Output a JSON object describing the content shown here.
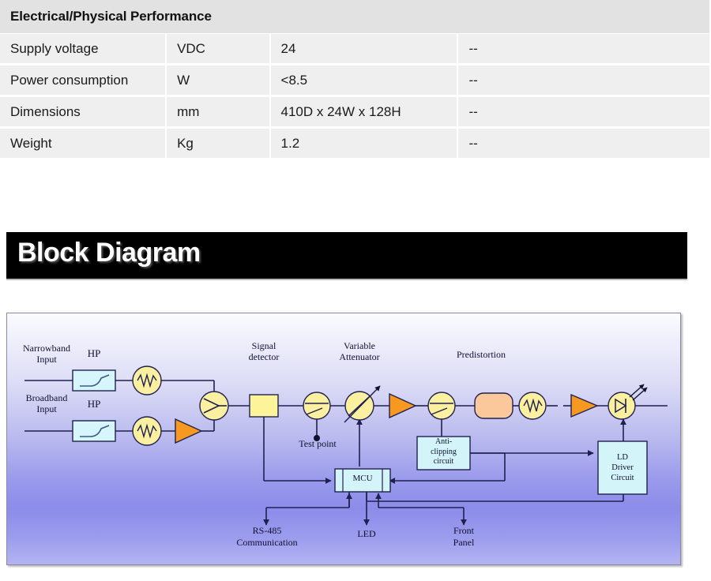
{
  "spec_table": {
    "header": "Electrical/Physical Performance",
    "rows": [
      {
        "parameter": "Supply voltage",
        "unit": "VDC",
        "value": "24",
        "note": "--"
      },
      {
        "parameter": "Power consumption",
        "unit": "W",
        "value": "<8.5",
        "note": "--"
      },
      {
        "parameter": "Dimensions",
        "unit": "mm",
        "value": "410D x 24W x 128H",
        "note": "--"
      },
      {
        "parameter": "Weight",
        "unit": "Kg",
        "value": "1.2",
        "note": "--"
      }
    ]
  },
  "banner": {
    "title": "Block Diagram"
  },
  "diagram": {
    "labels": {
      "narrowband_input": "Narrowband",
      "narrowband_input2": "Input",
      "broadband_input": "Broadband",
      "broadband_input2": "Input",
      "hp_top": "HP",
      "hp_bottom": "HP",
      "signal_detector": "Signal",
      "signal_detector2": "detector",
      "variable_attenuator": "Variable",
      "variable_attenuator2": "Attenuator",
      "predistortion": "Predistortion",
      "test_point": "Test point",
      "anti_clipping_1": "Anti-",
      "anti_clipping_2": "clipping",
      "anti_clipping_3": "circuit",
      "ld_driver_1": "LD",
      "ld_driver_2": "Driver",
      "ld_driver_3": "Circuit",
      "mcu": "MCU",
      "rs485_1": "RS-485",
      "rs485_2": "Communication",
      "led": "LED",
      "front_panel_1": "Front",
      "front_panel_2": "Panel"
    },
    "colors": {
      "filter_fill": "#d6f6fb",
      "circle_fill": "#fbf0a0",
      "amp_fill": "#f79820",
      "detector_fill": "#fdf49a",
      "predistortion_fill": "#fac89a",
      "box_fill": "#d3f4f9",
      "line": "#202050",
      "frame_border": "#8a8aa8",
      "banner_bg": "#000000",
      "table_header_bg": "#e2e2e2",
      "table_cell_bg": "#efefef"
    }
  }
}
